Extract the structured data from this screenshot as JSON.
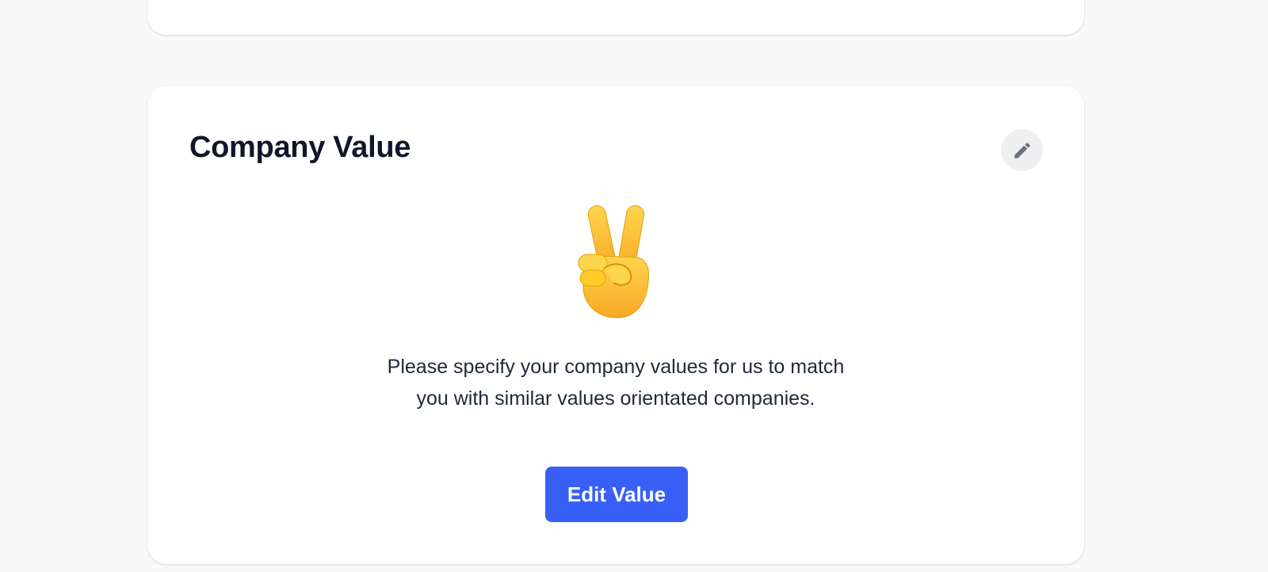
{
  "section": {
    "title": "Company Value",
    "edit_icon": "pencil-icon",
    "illustration_icon": "victory-hand-emoji",
    "description": "Please specify your company values for us to match you with similar values orientated companies.",
    "button_label": "Edit Value"
  },
  "colors": {
    "page_background": "#f9f9f9",
    "card_background": "#ffffff",
    "title": "#0f172a",
    "body_text": "#1e293b",
    "primary_button": "#3860f7",
    "icon_button_bg": "#efeff1",
    "icon_gray": "#6b7280",
    "emoji_yellow": "#fbc02d"
  }
}
